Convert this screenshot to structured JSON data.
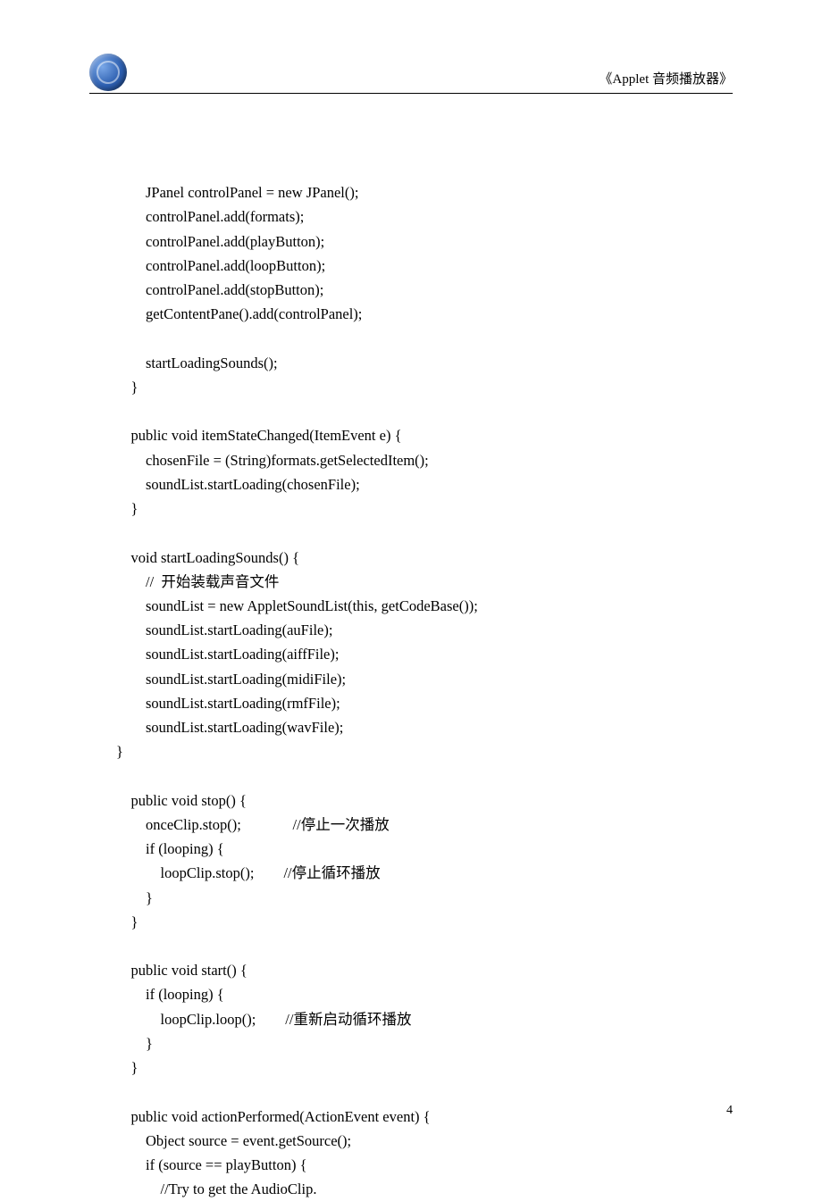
{
  "header": {
    "title": "《Applet 音频播放器》"
  },
  "code_lines": [
    "",
    "        JPanel controlPanel = new JPanel();",
    "        controlPanel.add(formats);",
    "        controlPanel.add(playButton);",
    "        controlPanel.add(loopButton);",
    "        controlPanel.add(stopButton);",
    "        getContentPane().add(controlPanel);",
    "",
    "        startLoadingSounds();",
    "    }",
    "",
    "    public void itemStateChanged(ItemEvent e) {",
    "        chosenFile = (String)formats.getSelectedItem();",
    "        soundList.startLoading(chosenFile);",
    "    }",
    "",
    "    void startLoadingSounds() {",
    "        //  开始装载声音文件",
    "        soundList = new AppletSoundList(this, getCodeBase());",
    "        soundList.startLoading(auFile);",
    "        soundList.startLoading(aiffFile);",
    "        soundList.startLoading(midiFile);",
    "        soundList.startLoading(rmfFile);",
    "        soundList.startLoading(wavFile);",
    "}",
    "",
    "    public void stop() {",
    "        onceClip.stop();              //停止一次播放",
    "        if (looping) {",
    "            loopClip.stop();        //停止循环播放",
    "        }",
    "    }",
    "",
    "    public void start() {",
    "        if (looping) {",
    "            loopClip.loop();        //重新启动循环播放",
    "        }",
    "    }",
    "",
    "    public void actionPerformed(ActionEvent event) {",
    "        Object source = event.getSource();",
    "        if (source == playButton) {",
    "            //Try to get the AudioClip."
  ],
  "page_number": "4"
}
